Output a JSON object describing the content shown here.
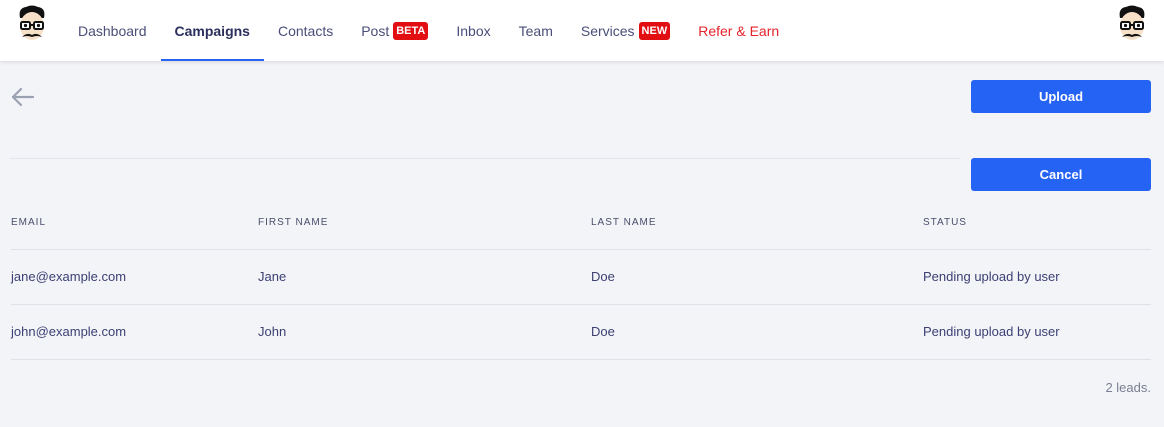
{
  "nav": {
    "items": [
      {
        "label": "Dashboard",
        "active": false
      },
      {
        "label": "Campaigns",
        "active": true
      },
      {
        "label": "Contacts",
        "active": false
      },
      {
        "label": "Post",
        "badge": "BETA"
      },
      {
        "label": "Inbox"
      },
      {
        "label": "Team"
      },
      {
        "label": "Services",
        "badge": "NEW"
      },
      {
        "label": "Refer & Earn"
      }
    ]
  },
  "icons": {
    "logo": "mustache-glasses-avatar-icon",
    "back": "arrow-left-icon"
  },
  "actions": {
    "upload_label": "Upload",
    "cancel_label": "Cancel"
  },
  "table": {
    "headers": [
      "EMAIL",
      "FIRST NAME",
      "LAST NAME",
      "STATUS"
    ],
    "rows": [
      {
        "email": "jane@example.com",
        "first_name": "Jane",
        "last_name": "Doe",
        "status": "Pending upload by user"
      },
      {
        "email": "john@example.com",
        "first_name": "John",
        "last_name": "Doe",
        "status": "Pending upload by user"
      }
    ]
  },
  "footer": {
    "count_label": "2 leads."
  },
  "colors": {
    "accent": "#2563f5",
    "badge": "#e10f12",
    "refer": "#e3242b"
  }
}
